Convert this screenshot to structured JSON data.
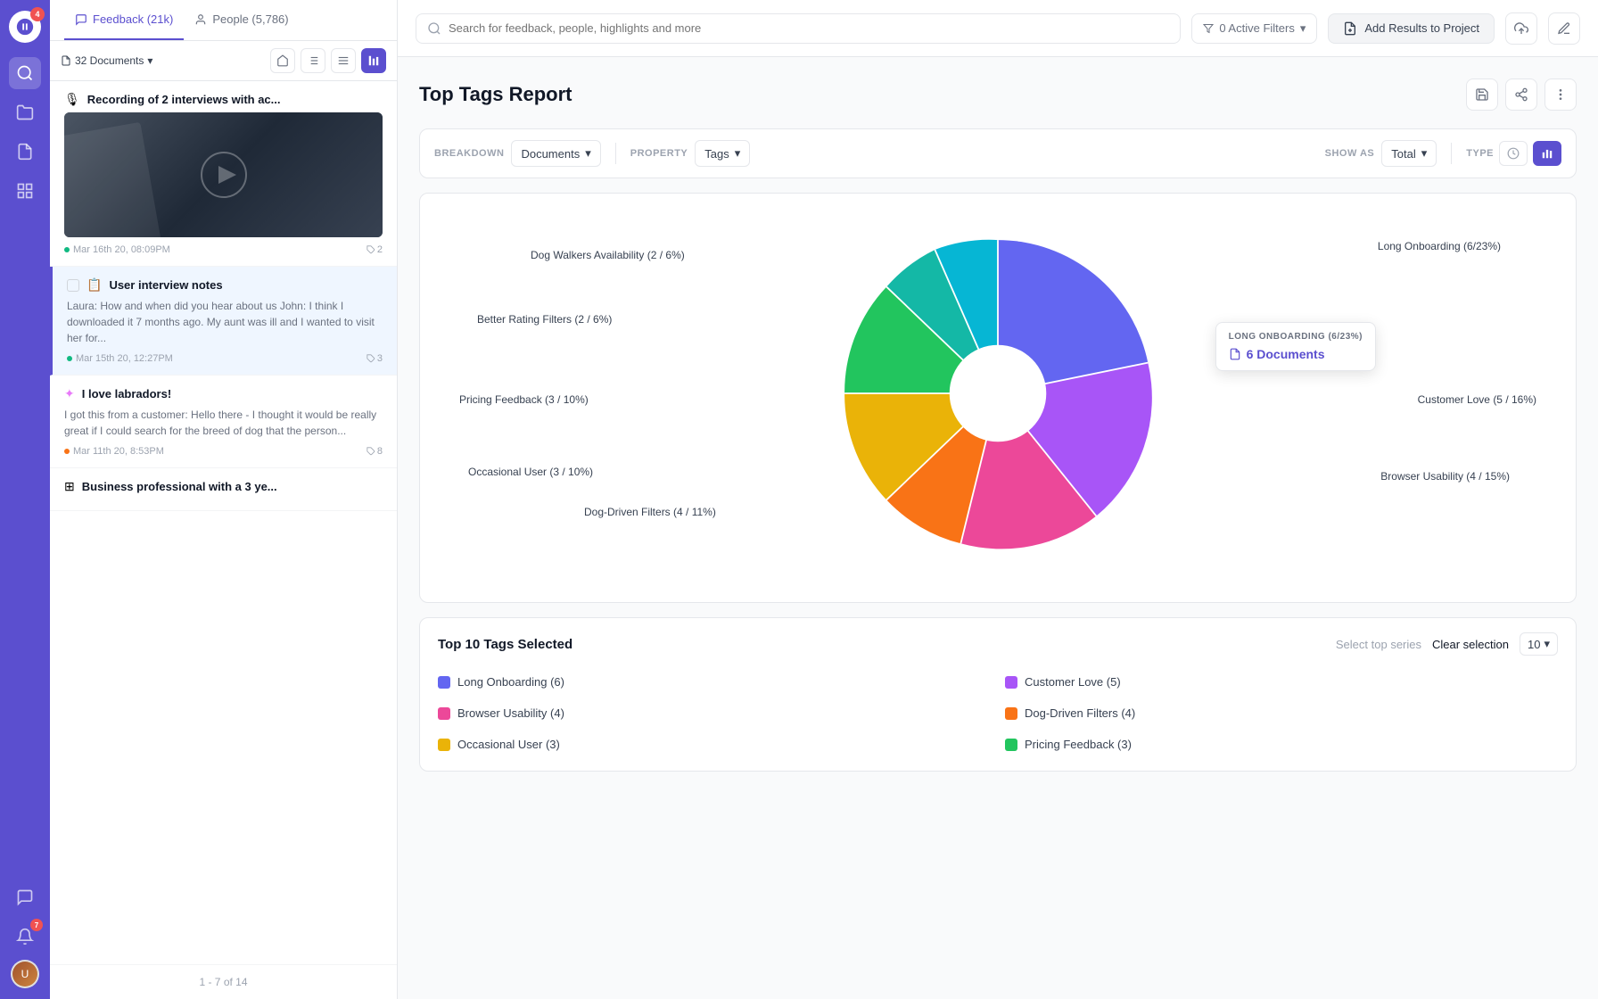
{
  "app": {
    "logo_badge": "4"
  },
  "nav": {
    "items": [
      {
        "id": "search",
        "icon": "search",
        "active": true
      },
      {
        "id": "folder",
        "icon": "folder"
      },
      {
        "id": "document",
        "icon": "document"
      },
      {
        "id": "grid",
        "icon": "grid"
      }
    ],
    "bottom": [
      {
        "id": "feedback",
        "icon": "feedback"
      },
      {
        "id": "bell",
        "icon": "bell",
        "badge": "7"
      }
    ]
  },
  "left_panel": {
    "tabs": [
      {
        "id": "feedback",
        "label": "Feedback (21k)",
        "active": true
      },
      {
        "id": "people",
        "label": "People (5,786)"
      }
    ],
    "toolbar": {
      "docs_label": "32 Documents"
    },
    "documents": [
      {
        "id": "doc1",
        "title": "Recording of 2 interviews with ac...",
        "type": "recording",
        "has_thumbnail": true,
        "date": "Mar 16th 20, 08:09PM",
        "tag_count": "2",
        "status": "active"
      },
      {
        "id": "doc2",
        "title": "User interview notes",
        "type": "notes",
        "selected": true,
        "excerpt": "Laura: How and when did you hear about us John:  I think I downloaded it 7 months ago. My aunt was ill and I wanted to visit her for...",
        "date": "Mar 15th 20, 12:27PM",
        "tag_count": "3",
        "status": "active"
      },
      {
        "id": "doc3",
        "title": "I love labradors!",
        "type": "slack",
        "excerpt": "I got this from a customer: Hello there - I thought it would be really great if I could search for the breed of dog that the person...",
        "date": "Mar 11th 20, 8:53PM",
        "tag_count": "8",
        "status": "orange"
      },
      {
        "id": "doc4",
        "title": "Business professional with a 3 ye...",
        "type": "grid"
      }
    ],
    "pagination": "1 - 7 of 14"
  },
  "top_bar": {
    "search_placeholder": "Search for feedback, people, highlights and more",
    "filter_label": "0 Active Filters",
    "add_results_label": "Add Results to Project"
  },
  "report": {
    "title": "Top Tags Report",
    "filters": {
      "breakdown_label": "BREAKDOWN",
      "breakdown_value": "Documents",
      "property_label": "PROPERTY",
      "property_value": "Tags",
      "show_as_label": "SHOW AS",
      "show_as_value": "Total",
      "type_label": "TYPE"
    },
    "chart": {
      "tooltip": {
        "title": "LONG ONBOARDING (6/23%)",
        "docs_label": "6 Documents"
      },
      "segments": [
        {
          "id": "long_onboarding",
          "label": "Long Onboarding (6/23%)",
          "value": 23,
          "color": "#6366f1",
          "startAngle": -90,
          "endAngle": -7
        },
        {
          "id": "customer_love",
          "label": "Customer Love (5 / 16%)",
          "value": 16,
          "color": "#a855f7",
          "startAngle": -7,
          "endAngle": 50
        },
        {
          "id": "browser_usability",
          "label": "Browser Usability (4 / 15%)",
          "value": 15,
          "color": "#ec4899",
          "startAngle": 50,
          "endAngle": 104
        },
        {
          "id": "dog_driven",
          "label": "Dog-Driven Filters (4 / 11%)",
          "value": 11,
          "color": "#f97316",
          "startAngle": 104,
          "endAngle": 144
        },
        {
          "id": "occasional_user",
          "label": "Occasional User (3 / 10%)",
          "value": 10,
          "color": "#eab308",
          "startAngle": 144,
          "endAngle": 180
        },
        {
          "id": "pricing_feedback",
          "label": "Pricing Feedback (3 / 10%)",
          "value": 10,
          "color": "#22c55e",
          "startAngle": 180,
          "endAngle": 216
        },
        {
          "id": "better_rating",
          "label": "Better Rating Filters (2 / 6%)",
          "value": 6,
          "color": "#14b8a6",
          "startAngle": 216,
          "endAngle": 238
        },
        {
          "id": "dog_walkers",
          "label": "Dog Walkers Availability (2 / 6%)",
          "value": 6,
          "color": "#06b6d4",
          "startAngle": 238,
          "endAngle": 260
        },
        {
          "id": "other",
          "label": "",
          "value": 3,
          "color": "#818cf8",
          "startAngle": 260,
          "endAngle": 270
        }
      ]
    },
    "bottom": {
      "title": "Top 10 Tags Selected",
      "select_top_series": "Select top series",
      "clear_selection": "Clear selection",
      "top_count": "10",
      "tags": [
        {
          "id": "long_onboarding",
          "label": "Long Onboarding (6)",
          "color": "#6366f1",
          "col": 1
        },
        {
          "id": "customer_love",
          "label": "Customer Love (5)",
          "color": "#a855f7",
          "col": 2
        },
        {
          "id": "browser_usability",
          "label": "Browser Usability (4)",
          "color": "#ec4899",
          "col": 1
        },
        {
          "id": "dog_driven",
          "label": "Dog-Driven Filters (4)",
          "color": "#f97316",
          "col": 2
        },
        {
          "id": "occasional_user",
          "label": "Occasional User (3)",
          "color": "#eab308",
          "col": 1
        },
        {
          "id": "pricing_feedback",
          "label": "Pricing Feedback (3)",
          "color": "#22c55e",
          "col": 2
        }
      ]
    }
  }
}
